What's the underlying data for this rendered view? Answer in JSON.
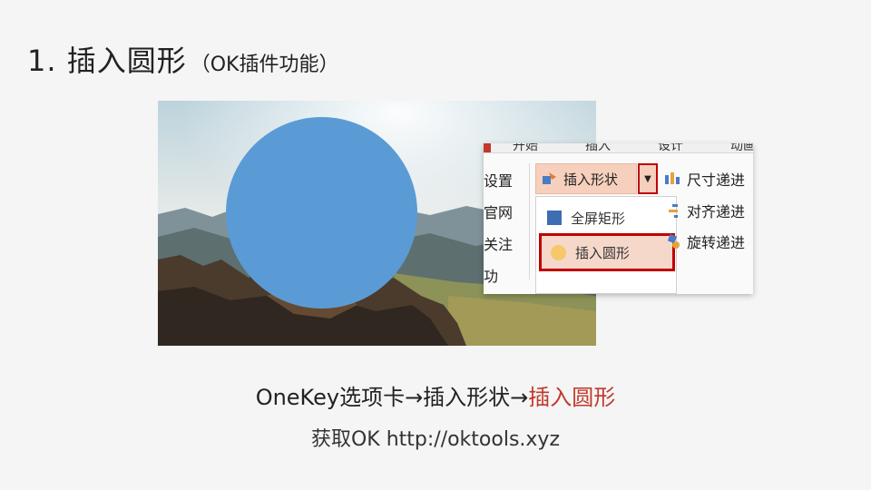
{
  "slide": {
    "title_main": "1. 插入圆形",
    "title_sub": "（OK插件功能）"
  },
  "ribbon": {
    "tabs": [
      "开始",
      "插入",
      "设计",
      "动画"
    ],
    "left_items": [
      "设置",
      "官网",
      "关注",
      "功"
    ],
    "insert_shape_label": "插入形状",
    "dropdown_arrow_icon": "caret-down-icon",
    "dropdown": [
      {
        "label": "全屏矩形",
        "icon": "square-icon",
        "color": "#3d6eb4"
      },
      {
        "label": "插入圆形",
        "icon": "circle-icon",
        "color": "#f5c869",
        "highlighted": true
      }
    ],
    "right_items": [
      {
        "label": "尺寸递进",
        "icon": "size-step-icon"
      },
      {
        "label": "对齐递进",
        "icon": "align-step-icon"
      },
      {
        "label": "旋转递进",
        "icon": "rotate-step-icon"
      }
    ]
  },
  "caption": {
    "path": "OneKey选项卡→插入形状→",
    "highlight": "插入圆形",
    "highlight_color": "#c0392b"
  },
  "subcaption": "获取OK  http://oktools.xyz",
  "colors": {
    "circle": "#5b9bd5",
    "selection_border": "#c00000",
    "button_bg": "#f6d0bd"
  }
}
